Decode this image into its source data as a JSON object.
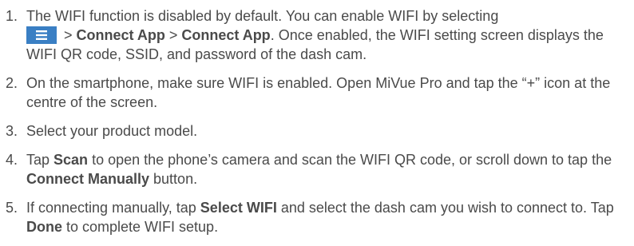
{
  "steps": [
    {
      "num": "1.",
      "parts": {
        "a": "The WIFI function is disabled by default. You can enable WIFI by selecting",
        "b": " > ",
        "c": "Connect App",
        "d": " > ",
        "e": "Connect App",
        "f": ". Once enabled, the WIFI setting screen displays the WIFI QR code, SSID, and password of the dash cam."
      },
      "icon": "menu-icon"
    },
    {
      "num": "2.",
      "text": "On the smartphone, make sure WIFI is enabled. Open MiVue Pro and tap the “+” icon at the centre of the screen."
    },
    {
      "num": "3.",
      "text": "Select your product model."
    },
    {
      "num": "4.",
      "parts": {
        "a": "Tap ",
        "b": "Scan",
        "c": " to open the phone’s camera and scan the WIFI QR code, or scroll down to tap the ",
        "d": "Connect Manually",
        "e": " button."
      }
    },
    {
      "num": "5.",
      "parts": {
        "a": "If connecting manually, tap ",
        "b": "Select WIFI",
        "c": " and select the dash cam you wish to connect to. Tap ",
        "d": "Done",
        "e": " to complete WIFI setup."
      }
    }
  ],
  "colors": {
    "text": "#4a4a4a",
    "icon_bg": "#3a7fc4"
  }
}
